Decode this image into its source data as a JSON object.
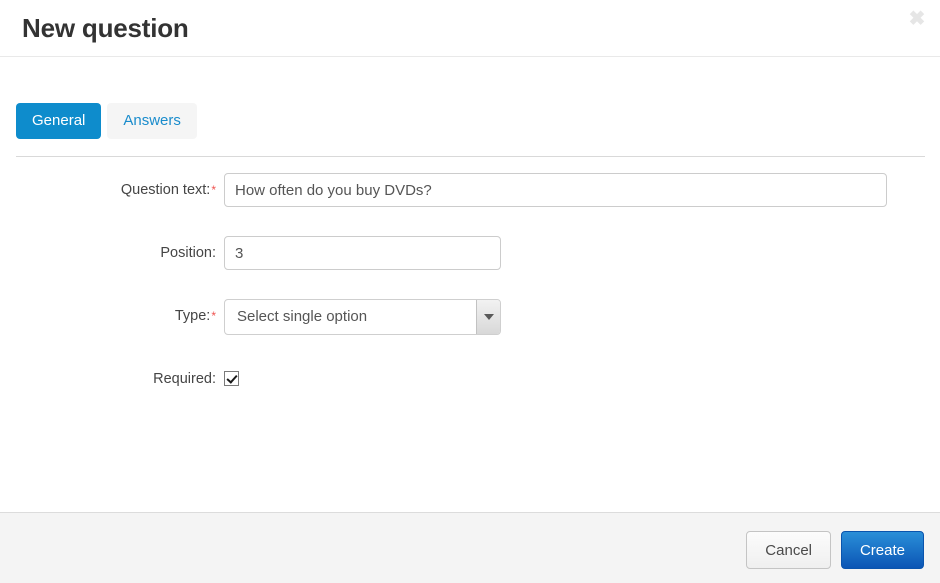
{
  "dialog": {
    "title": "New question",
    "close_icon": "close-icon",
    "close_label": "✖"
  },
  "tabs": [
    {
      "label": "General",
      "active": true
    },
    {
      "label": "Answers",
      "active": false
    }
  ],
  "form": {
    "fields": [
      {
        "label": "Question text:",
        "required": true,
        "required_marker": "*",
        "type": "text",
        "value": "How often do you buy DVDs?",
        "placeholder": ""
      },
      {
        "label": "Position:",
        "required": false,
        "required_marker": "",
        "type": "text",
        "value": "3",
        "placeholder": ""
      },
      {
        "label": "Type:",
        "required": true,
        "required_marker": "*",
        "type": "select",
        "value": "Select single option",
        "arrow_icon": "chevron-down-icon"
      },
      {
        "label": "Required:",
        "required": false,
        "required_marker": "",
        "type": "checkbox",
        "checked": true
      }
    ]
  },
  "footer": {
    "cancel_label": "Cancel",
    "create_label": "Create"
  },
  "colors": {
    "tab_active_bg": "#0e8ccc",
    "tab_inactive_bg": "#f5f5f5",
    "tab_inactive_text": "#1a8ccc",
    "required_star": "#ef5350",
    "create_button_bg": "#0b55b5",
    "footer_bg": "#f4f4f4",
    "title_text": "#333333"
  }
}
